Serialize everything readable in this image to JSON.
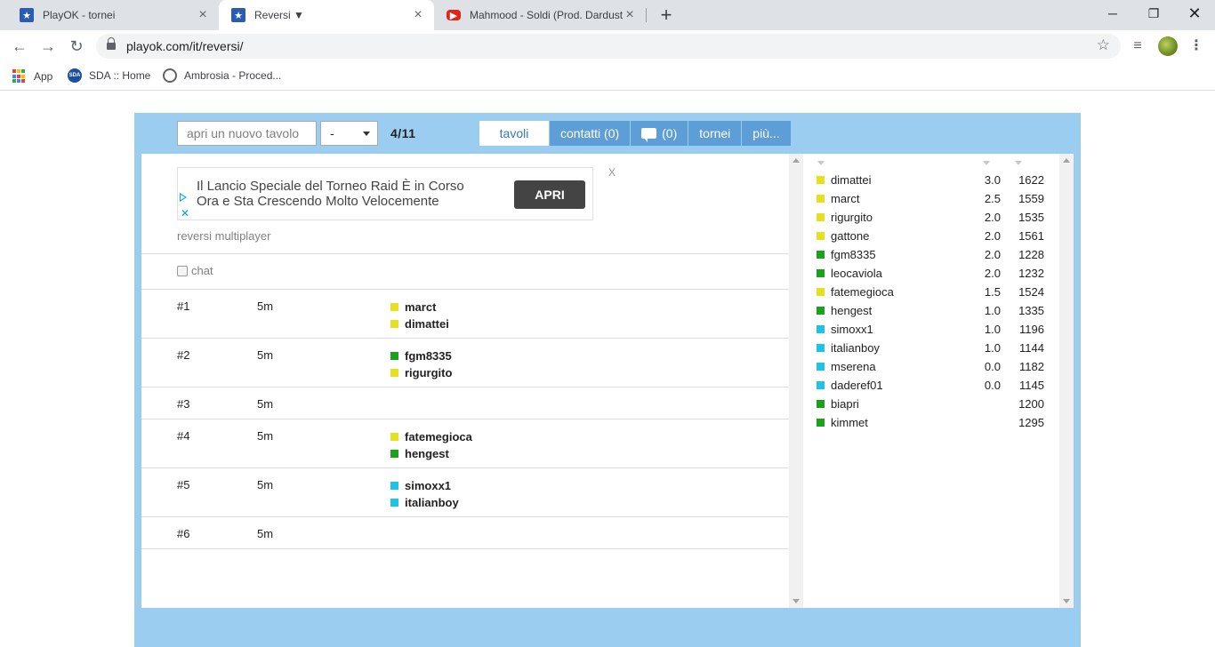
{
  "browser": {
    "tabs": [
      {
        "title": "PlayOK - tornei",
        "icon": "playok-star-icon",
        "active": false
      },
      {
        "title": "Reversi ▼",
        "icon": "playok-star-icon",
        "active": true
      },
      {
        "title": "Mahmood - Soldi (Prod. Dardust",
        "icon": "youtube-icon",
        "active": false
      }
    ],
    "url": "playok.com/it/reversi/",
    "bookmarks": [
      {
        "label": "App",
        "icon": "apps-grid-icon"
      },
      {
        "label": "SDA :: Home",
        "icon": "sda-icon"
      },
      {
        "label": "Ambrosia - Proced...",
        "icon": "globe-icon"
      }
    ]
  },
  "controls": {
    "new_table_label": "apri un nuovo tavolo",
    "select_value": "-",
    "count": "4/11"
  },
  "nav": {
    "tables": "tavoli",
    "contacts": "contatti (0)",
    "messages": "(0)",
    "tournaments": "tornei",
    "more": "più..."
  },
  "ad": {
    "line1": "Il Lancio Speciale del Torneo Raid È in Corso",
    "line2": "Ora e Sta Crescendo Molto Velocemente",
    "button": "APRI",
    "close": "X"
  },
  "lobby": {
    "subtitle": "reversi multiplayer",
    "chat_label": "chat"
  },
  "colors": {
    "yellow": "#e6e01e",
    "green": "#1aa31a",
    "cyan": "#1ec3e6"
  },
  "tables": [
    {
      "num": "#1",
      "time": "5m",
      "players": [
        {
          "name": "marct",
          "color": "yellow"
        },
        {
          "name": "dimattei",
          "color": "yellow"
        }
      ]
    },
    {
      "num": "#2",
      "time": "5m",
      "players": [
        {
          "name": "fgm8335",
          "color": "green"
        },
        {
          "name": "rigurgito",
          "color": "yellow"
        }
      ]
    },
    {
      "num": "#3",
      "time": "5m",
      "players": []
    },
    {
      "num": "#4",
      "time": "5m",
      "players": [
        {
          "name": "fatemegioca",
          "color": "yellow"
        },
        {
          "name": "hengest",
          "color": "green"
        }
      ]
    },
    {
      "num": "#5",
      "time": "5m",
      "players": [
        {
          "name": "simoxx1",
          "color": "cyan"
        },
        {
          "name": "italianboy",
          "color": "cyan"
        }
      ]
    },
    {
      "num": "#6",
      "time": "5m",
      "players": []
    }
  ],
  "ranking": [
    {
      "name": "dimattei",
      "score": "3.0",
      "rating": "1622",
      "color": "yellow"
    },
    {
      "name": "marct",
      "score": "2.5",
      "rating": "1559",
      "color": "yellow"
    },
    {
      "name": "rigurgito",
      "score": "2.0",
      "rating": "1535",
      "color": "yellow"
    },
    {
      "name": "gattone",
      "score": "2.0",
      "rating": "1561",
      "color": "yellow"
    },
    {
      "name": "fgm8335",
      "score": "2.0",
      "rating": "1228",
      "color": "green"
    },
    {
      "name": "leocaviola",
      "score": "2.0",
      "rating": "1232",
      "color": "green"
    },
    {
      "name": "fatemegioca",
      "score": "1.5",
      "rating": "1524",
      "color": "yellow"
    },
    {
      "name": "hengest",
      "score": "1.0",
      "rating": "1335",
      "color": "green"
    },
    {
      "name": "simoxx1",
      "score": "1.0",
      "rating": "1196",
      "color": "cyan"
    },
    {
      "name": "italianboy",
      "score": "1.0",
      "rating": "1144",
      "color": "cyan"
    },
    {
      "name": "mserena",
      "score": "0.0",
      "rating": "1182",
      "color": "cyan"
    },
    {
      "name": "daderef01",
      "score": "0.0",
      "rating": "1145",
      "color": "cyan"
    },
    {
      "name": "biapri",
      "score": "",
      "rating": "1200",
      "color": "green"
    },
    {
      "name": "kimmet",
      "score": "",
      "rating": "1295",
      "color": "green"
    }
  ]
}
